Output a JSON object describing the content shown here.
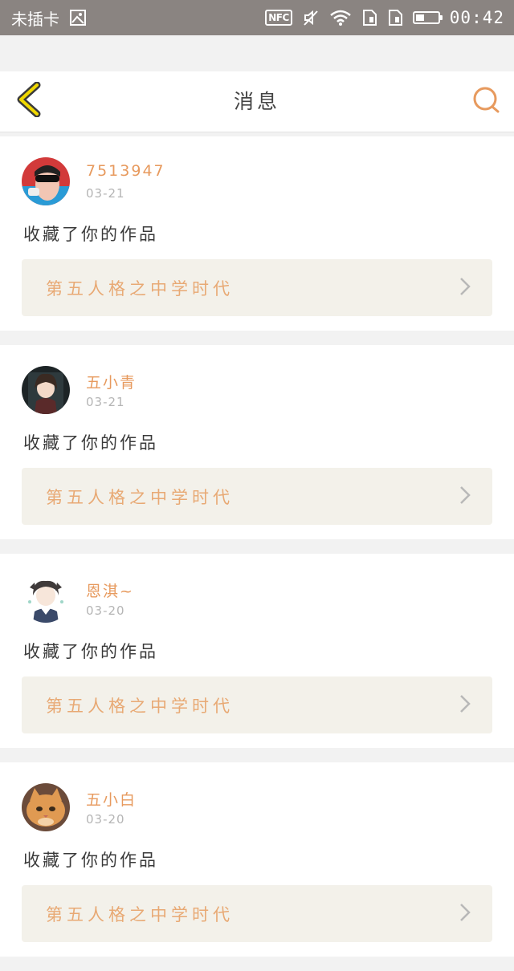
{
  "status_bar": {
    "carrier": "未插卡",
    "nfc": "NFC",
    "time": "00:42",
    "battery_level": 0.4
  },
  "header": {
    "title": "消息",
    "back_icon": "chevron-left-icon",
    "search_icon": "search-icon"
  },
  "colors": {
    "accent_orange": "#e79a5e",
    "back_yellow": "#f0d800",
    "work_box_bg": "#f3f1ea"
  },
  "messages": [
    {
      "username": "7513947",
      "date": "03-21",
      "action": "收藏了你的作品",
      "work_title": "第五人格之中学时代"
    },
    {
      "username": "五小青",
      "date": "03-21",
      "action": "收藏了你的作品",
      "work_title": "第五人格之中学时代"
    },
    {
      "username": "恩淇~",
      "date": "03-20",
      "action": "收藏了你的作品",
      "work_title": "第五人格之中学时代"
    },
    {
      "username": "五小白",
      "date": "03-20",
      "action": "收藏了你的作品",
      "work_title": "第五人格之中学时代"
    }
  ]
}
